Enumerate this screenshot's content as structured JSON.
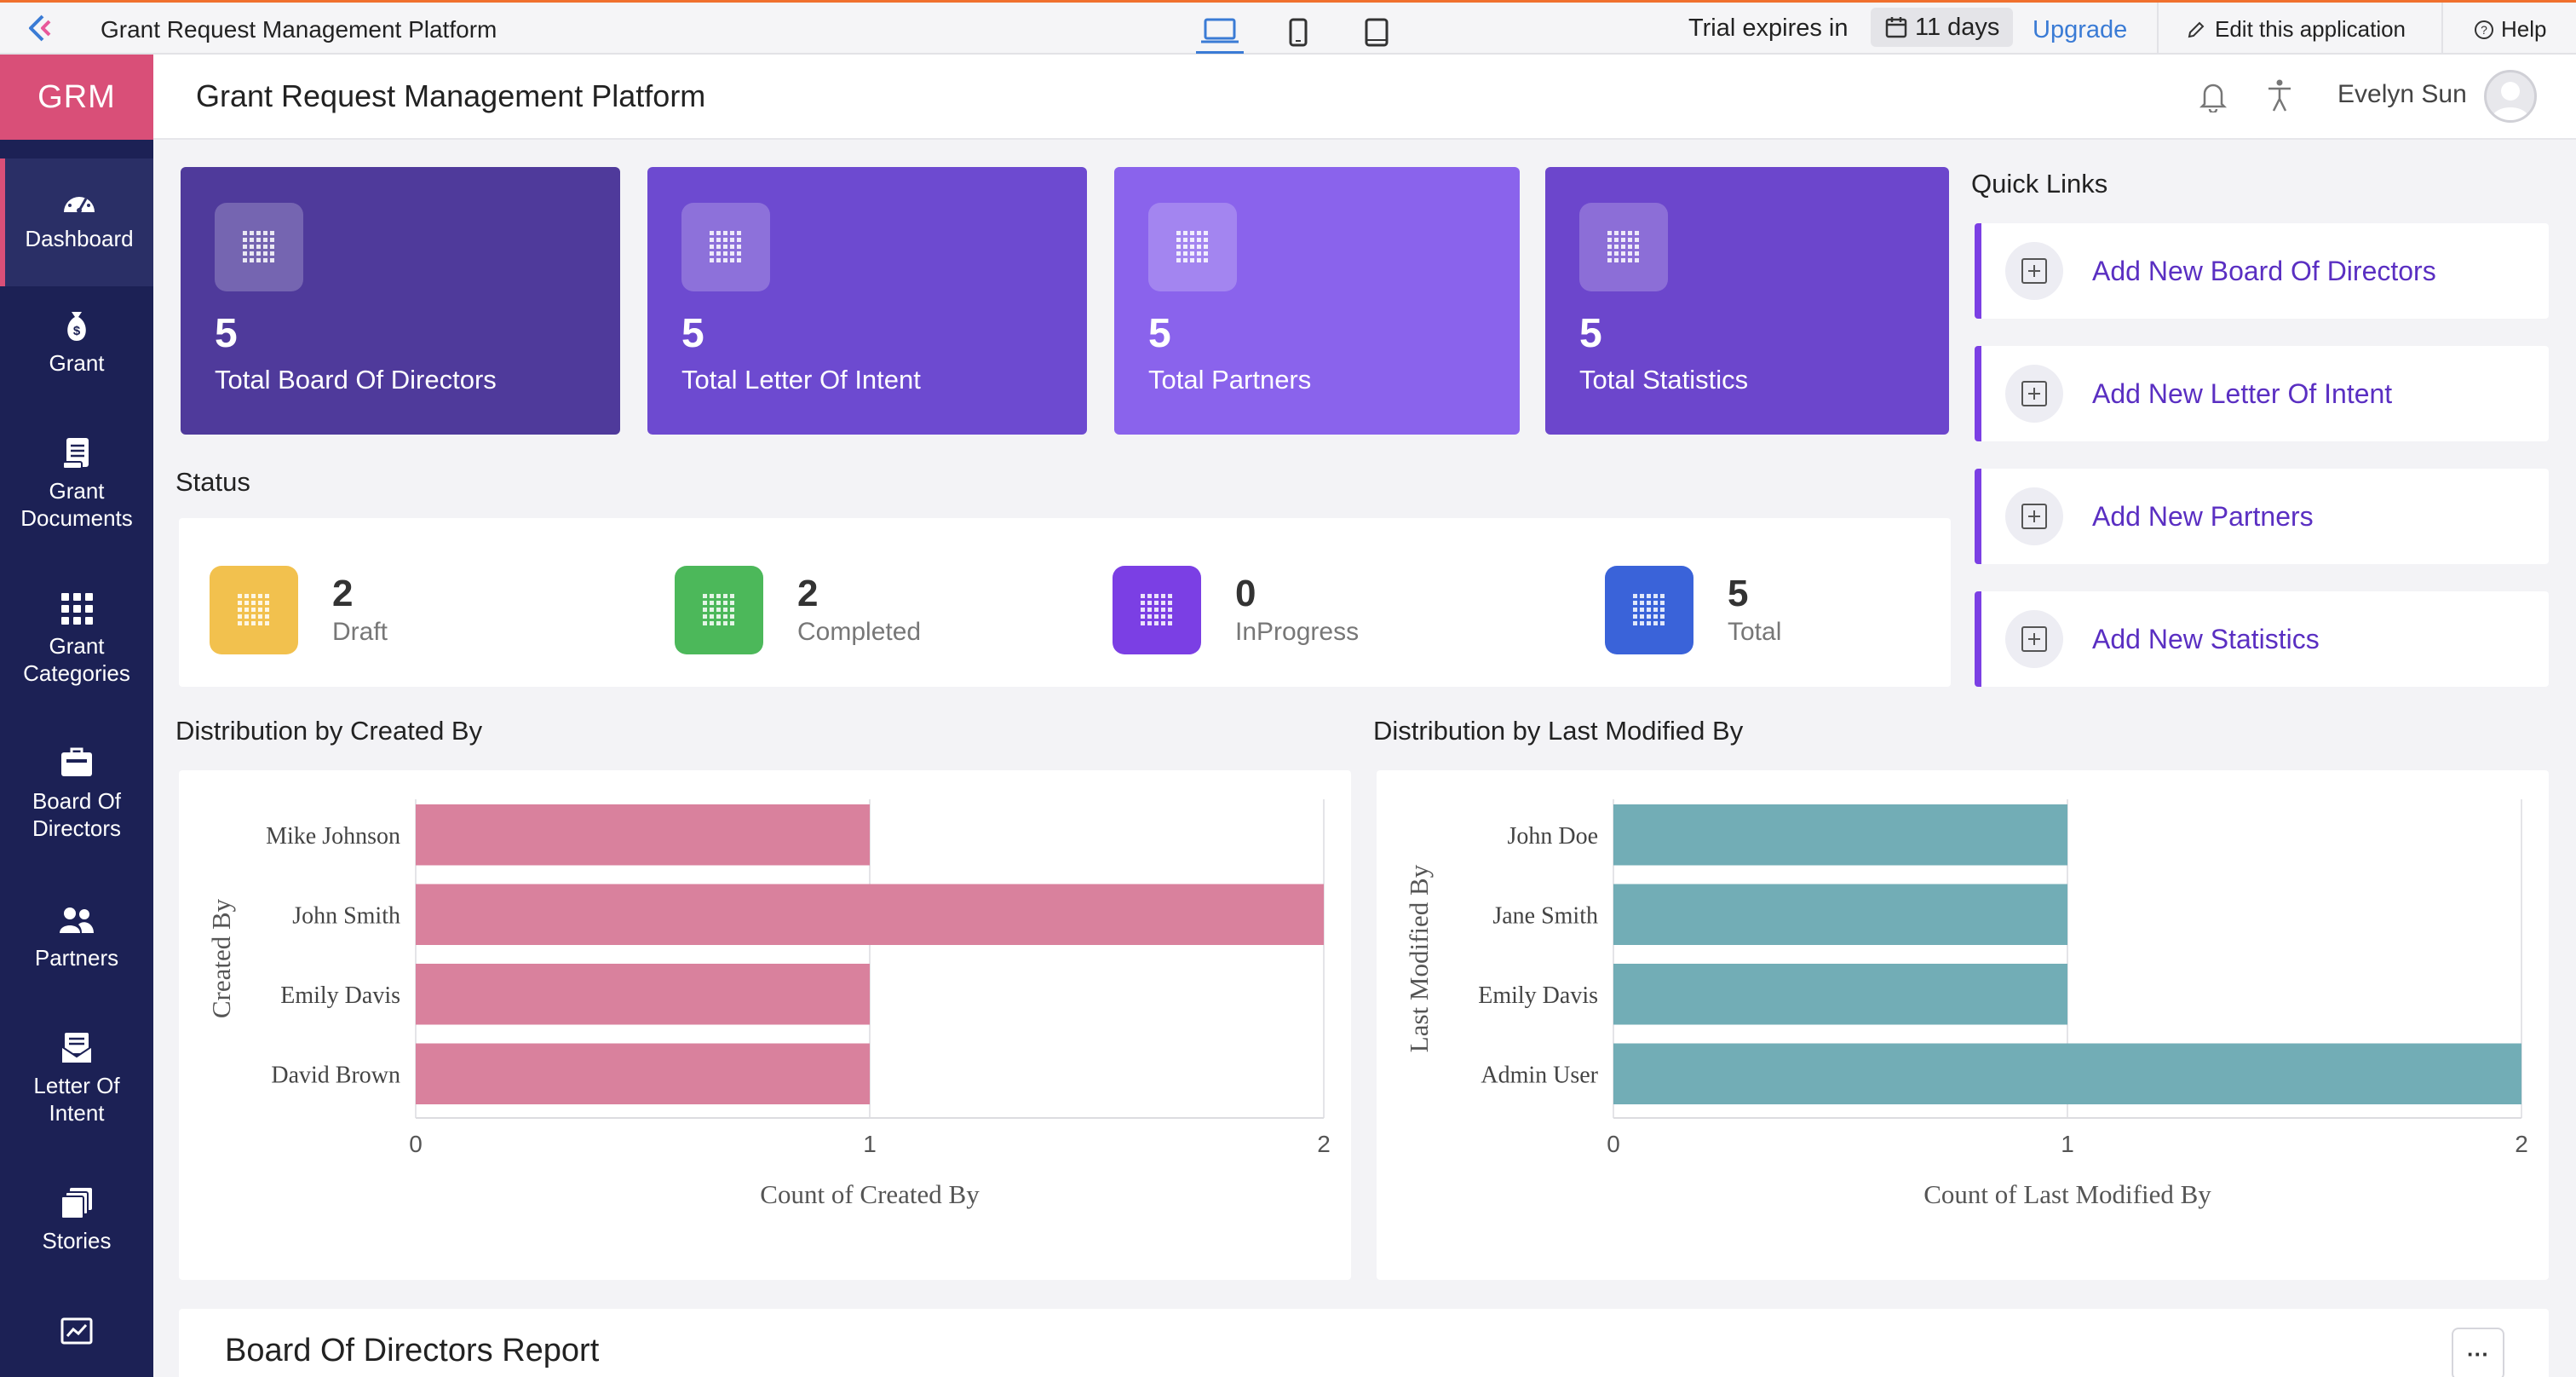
{
  "topbar": {
    "app_name": "Grant Request Management Platform",
    "trial_text": "Trial expires in",
    "trial_days": "11 days",
    "upgrade": "Upgrade",
    "edit_app": "Edit this application",
    "help": "Help"
  },
  "sidebar": {
    "brand": "GRM",
    "items": [
      {
        "label": "Dashboard",
        "icon": "dashboard-icon"
      },
      {
        "label": "Grant",
        "icon": "money-bag-icon"
      },
      {
        "label": "Grant Documents",
        "icon": "document-icon"
      },
      {
        "label": "Grant Categories",
        "icon": "grid-icon"
      },
      {
        "label": "Board Of Directors",
        "icon": "briefcase-icon"
      },
      {
        "label": "Partners",
        "icon": "people-icon"
      },
      {
        "label": "Letter Of Intent",
        "icon": "envelope-icon"
      },
      {
        "label": "Stories",
        "icon": "stack-icon"
      },
      {
        "label": "",
        "icon": "chart-icon"
      }
    ]
  },
  "header": {
    "title": "Grant Request Management Platform",
    "user_name": "Evelyn Sun"
  },
  "cards": [
    {
      "value": "5",
      "label": "Total Board Of Directors",
      "color": "#4f3a9b"
    },
    {
      "value": "5",
      "label": "Total Letter Of Intent",
      "color": "#6d4ad0"
    },
    {
      "value": "5",
      "label": "Total Partners",
      "color": "#8a63ec"
    },
    {
      "value": "5",
      "label": "Total Statistics",
      "color": "#6c46cc"
    }
  ],
  "quick_links": {
    "title": "Quick Links",
    "items": [
      "Add New Board Of Directors",
      "Add New Letter Of Intent",
      "Add New Partners",
      "Add New Statistics"
    ]
  },
  "status": {
    "title": "Status",
    "items": [
      {
        "value": "2",
        "label": "Draft",
        "color": "#f2c14e"
      },
      {
        "value": "2",
        "label": "Completed",
        "color": "#4cb85a"
      },
      {
        "value": "0",
        "label": "InProgress",
        "color": "#7b3fe4"
      },
      {
        "value": "5",
        "label": "Total",
        "color": "#3a63d9"
      }
    ]
  },
  "charts": {
    "created_title": "Distribution by Created By",
    "modified_title": "Distribution by Last Modified By"
  },
  "chart_data": [
    {
      "type": "bar",
      "orientation": "horizontal",
      "title": "Distribution by Created By",
      "categories": [
        "Mike Johnson",
        "John Smith",
        "Emily Davis",
        "David Brown"
      ],
      "values": [
        1,
        2,
        1,
        1
      ],
      "xlabel": "Count of Created By",
      "ylabel": "Created By",
      "xlim": [
        0,
        2
      ],
      "ticks": [
        "0",
        "1",
        "2"
      ],
      "color": "#d9819d"
    },
    {
      "type": "bar",
      "orientation": "horizontal",
      "title": "Distribution by Last Modified By",
      "categories": [
        "John Doe",
        "Jane Smith",
        "Emily Davis",
        "Admin User"
      ],
      "values": [
        1,
        1,
        1,
        2
      ],
      "xlabel": "Count of Last Modified By",
      "ylabel": "Last Modified By",
      "xlim": [
        0,
        2
      ],
      "ticks": [
        "0",
        "1",
        "2"
      ],
      "color": "#72adb6"
    }
  ],
  "report": {
    "title": "Board Of Directors Report",
    "more": "···"
  }
}
